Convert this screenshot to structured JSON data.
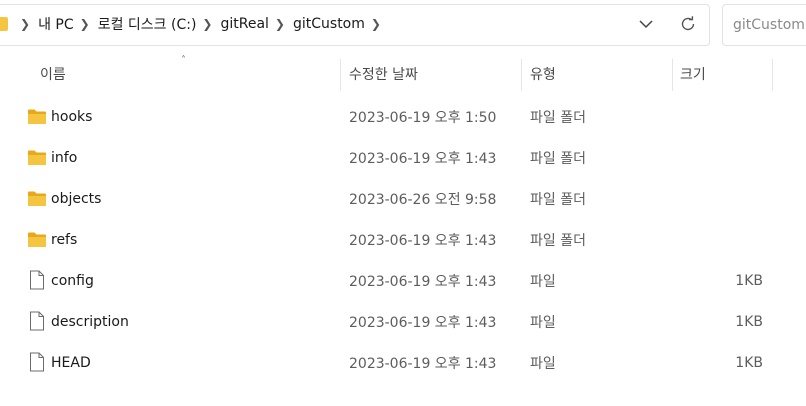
{
  "breadcrumb": {
    "items": [
      "내 PC",
      "로컬 디스크 (C:)",
      "gitReal",
      "gitCustom"
    ]
  },
  "search": {
    "placeholder": "gitCustom 검색"
  },
  "columns": {
    "name": "이름",
    "date": "수정한 날짜",
    "type": "유형",
    "size": "크기"
  },
  "sort": {
    "column": "name",
    "direction": "ascending"
  },
  "files": [
    {
      "name": "hooks",
      "date": "2023-06-19 오후 1:50",
      "type": "파일 폴더",
      "size": "",
      "kind": "folder"
    },
    {
      "name": "info",
      "date": "2023-06-19 오후 1:43",
      "type": "파일 폴더",
      "size": "",
      "kind": "folder"
    },
    {
      "name": "objects",
      "date": "2023-06-26 오전 9:58",
      "type": "파일 폴더",
      "size": "",
      "kind": "folder"
    },
    {
      "name": "refs",
      "date": "2023-06-19 오후 1:43",
      "type": "파일 폴더",
      "size": "",
      "kind": "folder"
    },
    {
      "name": "config",
      "date": "2023-06-19 오후 1:43",
      "type": "파일",
      "size": "1KB",
      "kind": "file"
    },
    {
      "name": "description",
      "date": "2023-06-19 오후 1:43",
      "type": "파일",
      "size": "1KB",
      "kind": "file"
    },
    {
      "name": "HEAD",
      "date": "2023-06-19 오후 1:43",
      "type": "파일",
      "size": "1KB",
      "kind": "file"
    }
  ],
  "icons": {
    "folder": "folder-icon",
    "file": "file-icon",
    "breadcrumb_separator": "chevron-right-icon",
    "history": "chevron-down-icon",
    "refresh": "refresh-icon",
    "sort": "sort-up-icon"
  },
  "colors": {
    "folder": "#f5c542",
    "folder_dark": "#e8a919",
    "text": "#1a1a1a",
    "muted": "#5d5d5d"
  }
}
